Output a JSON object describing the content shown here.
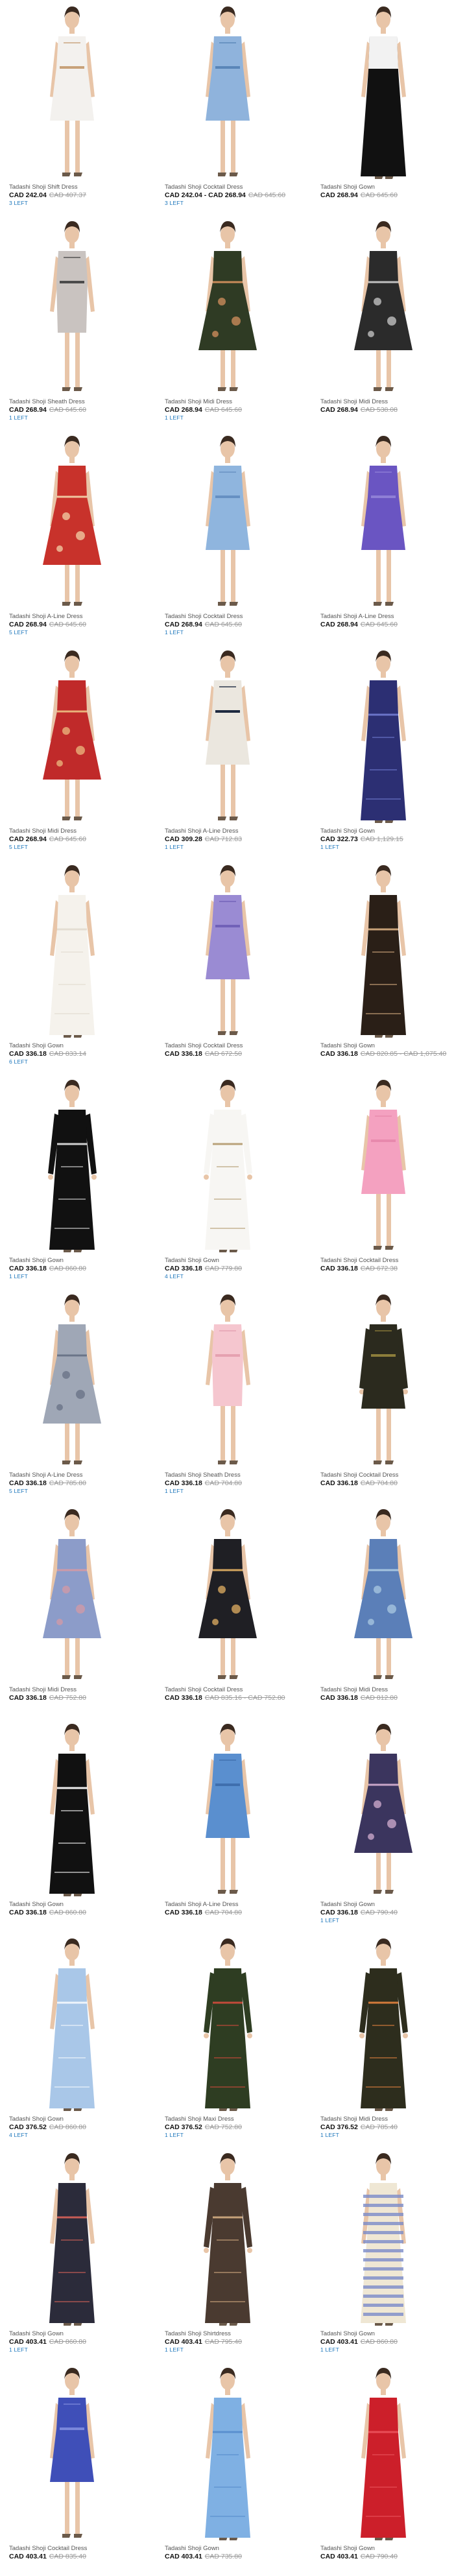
{
  "products": [
    {
      "title": "Tadashi Shoji Shift Dress",
      "price": "CAD 242.04",
      "was": "CAD 407.37",
      "stock": "3 LEFT",
      "color": "#f3f1ee",
      "accent": "#c8a27a",
      "style": "short",
      "icon": "dress-icon"
    },
    {
      "title": "Tadashi Shoji Cocktail Dress",
      "price": "CAD 242.04 - CAD 268.94",
      "was": "CAD 645.60",
      "stock": "3 LEFT",
      "color": "#8fb3dc",
      "accent": "#5a86b8",
      "style": "short",
      "icon": "dress-icon"
    },
    {
      "title": "Tadashi Shoji Gown",
      "price": "CAD 268.94",
      "was": "CAD 645.60",
      "stock": "",
      "color": "#111111",
      "accent": "#f2f2f2",
      "style": "gown-white-top",
      "icon": "gown-icon"
    },
    {
      "title": "Tadashi Shoji Sheath Dress",
      "price": "CAD 268.94",
      "was": "CAD 645.60",
      "stock": "1 LEFT",
      "color": "#c9c3c0",
      "accent": "#4b4b4b",
      "style": "sheath",
      "icon": "dress-icon"
    },
    {
      "title": "Tadashi Shoji Midi Dress",
      "price": "CAD 268.94",
      "was": "CAD 645.60",
      "stock": "1 LEFT",
      "color": "#2f3b24",
      "accent": "#c98b5a",
      "style": "midi",
      "icon": "dress-icon"
    },
    {
      "title": "Tadashi Shoji Midi Dress",
      "price": "CAD 268.94",
      "was": "CAD 538.08",
      "stock": "",
      "color": "#2b2b2b",
      "accent": "#c0c0c0",
      "style": "midi",
      "icon": "dress-icon"
    },
    {
      "title": "Tadashi Shoji A-Line Dress",
      "price": "CAD 268.94",
      "was": "CAD 645.60",
      "stock": "5 LEFT",
      "color": "#c8322b",
      "accent": "#f0c7a0",
      "style": "midi",
      "icon": "dress-icon"
    },
    {
      "title": "Tadashi Shoji Cocktail Dress",
      "price": "CAD 268.94",
      "was": "CAD 645.60",
      "stock": "1 LEFT",
      "color": "#8fb5de",
      "accent": "#6690c2",
      "style": "short",
      "icon": "dress-icon"
    },
    {
      "title": "Tadashi Shoji A-Line Dress",
      "price": "CAD 268.94",
      "was": "CAD 645.60",
      "stock": "",
      "color": "#6a55c2",
      "accent": "#8f7fd6",
      "style": "short",
      "icon": "dress-icon"
    },
    {
      "title": "Tadashi Shoji Midi Dress",
      "price": "CAD 268.94",
      "was": "CAD 645.60",
      "stock": "5 LEFT",
      "color": "#c02a2a",
      "accent": "#e8b27a",
      "style": "midi",
      "icon": "dress-icon"
    },
    {
      "title": "Tadashi Shoji A-Line Dress",
      "price": "CAD 309.28",
      "was": "CAD 712.83",
      "stock": "1 LEFT",
      "color": "#ebe7df",
      "accent": "#1e2a40",
      "style": "short",
      "icon": "dress-icon"
    },
    {
      "title": "Tadashi Shoji Gown",
      "price": "CAD 322.73",
      "was": "CAD 1,129.15",
      "stock": "1 LEFT",
      "color": "#2c2f73",
      "accent": "#6b74c9",
      "style": "gown",
      "icon": "gown-icon"
    },
    {
      "title": "Tadashi Shoji Gown",
      "price": "CAD 336.18",
      "was": "CAD 833.14",
      "stock": "6 LEFT",
      "color": "#f5f2ec",
      "accent": "#e3ddd2",
      "style": "gown",
      "icon": "gown-icon"
    },
    {
      "title": "Tadashi Shoji Cocktail Dress",
      "price": "CAD 336.18",
      "was": "CAD 672.50",
      "stock": "",
      "color": "#9a8bd3",
      "accent": "#7161b8",
      "style": "short",
      "icon": "dress-icon"
    },
    {
      "title": "Tadashi Shoji Gown",
      "price": "CAD 336.18",
      "was": "CAD 820.85 - CAD 1,075.40",
      "stock": "",
      "color": "#2a1f17",
      "accent": "#c8a278",
      "style": "gown",
      "icon": "gown-icon"
    },
    {
      "title": "Tadashi Shoji Gown",
      "price": "CAD 336.18",
      "was": "CAD 860.80",
      "stock": "1 LEFT",
      "color": "#111111",
      "accent": "#cfcfcf",
      "style": "gown-sleeve",
      "icon": "gown-icon"
    },
    {
      "title": "Tadashi Shoji Gown",
      "price": "CAD 336.18",
      "was": "CAD 779.80",
      "stock": "4 LEFT",
      "color": "#f7f6f3",
      "accent": "#b9a27a",
      "style": "gown-sleeve",
      "icon": "gown-icon"
    },
    {
      "title": "Tadashi Shoji Cocktail Dress",
      "price": "CAD 336.18",
      "was": "CAD 672.38",
      "stock": "",
      "color": "#f4a1c0",
      "accent": "#e889ad",
      "style": "short",
      "icon": "dress-icon"
    },
    {
      "title": "Tadashi Shoji A-Line Dress",
      "price": "CAD 336.18",
      "was": "CAD 785.80",
      "stock": "5 LEFT",
      "color": "#9fa7b6",
      "accent": "#6a7488",
      "style": "midi",
      "icon": "dress-icon"
    },
    {
      "title": "Tadashi Shoji Sheath Dress",
      "price": "CAD 336.18",
      "was": "CAD 704.80",
      "stock": "1 LEFT",
      "color": "#f5c6cf",
      "accent": "#e5a1b0",
      "style": "sheath",
      "icon": "dress-icon"
    },
    {
      "title": "Tadashi Shoji Cocktail Dress",
      "price": "CAD 336.18",
      "was": "CAD 704.80",
      "stock": "",
      "color": "#2b2a1e",
      "accent": "#8c7d3a",
      "style": "short-sleeve",
      "icon": "dress-icon"
    },
    {
      "title": "Tadashi Shoji Midi Dress",
      "price": "CAD 336.18",
      "was": "CAD 752.80",
      "stock": "",
      "color": "#8c9cc9",
      "accent": "#cf9aa7",
      "style": "midi",
      "icon": "dress-icon"
    },
    {
      "title": "Tadashi Shoji Cocktail Dress",
      "price": "CAD 336.18",
      "was": "CAD 835.16 - CAD 752.80",
      "stock": "",
      "color": "#1f1f24",
      "accent": "#d4a55e",
      "style": "midi",
      "icon": "dress-icon"
    },
    {
      "title": "Tadashi Shoji Midi Dress",
      "price": "CAD 336.18",
      "was": "CAD 812.80",
      "stock": "",
      "color": "#5b7fb8",
      "accent": "#a5c4df",
      "style": "midi",
      "icon": "dress-icon"
    },
    {
      "title": "Tadashi Shoji Gown",
      "price": "CAD 336.18",
      "was": "CAD 860.80",
      "stock": "",
      "color": "#111111",
      "accent": "#ececec",
      "style": "gown",
      "icon": "gown-icon"
    },
    {
      "title": "Tadashi Shoji A-Line Dress",
      "price": "CAD 336.18",
      "was": "CAD 704.80",
      "stock": "",
      "color": "#5a8fcf",
      "accent": "#3f6fae",
      "style": "short",
      "icon": "dress-icon"
    },
    {
      "title": "Tadashi Shoji Gown",
      "price": "CAD 336.18",
      "was": "CAD 790.40",
      "stock": "1 LEFT",
      "color": "#3b355e",
      "accent": "#c9a6c8",
      "style": "midi",
      "icon": "gown-icon"
    },
    {
      "title": "Tadashi Shoji Gown",
      "price": "CAD 376.52",
      "was": "CAD 860.80",
      "stock": "4 LEFT",
      "color": "#a9c7e8",
      "accent": "#eef4fb",
      "style": "gown",
      "icon": "gown-icon"
    },
    {
      "title": "Tadashi Shoji Maxi Dress",
      "price": "CAD 376.52",
      "was": "CAD 752.80",
      "stock": "1 LEFT",
      "color": "#2e3d22",
      "accent": "#c24a3a",
      "style": "gown-sleeve",
      "icon": "gown-icon"
    },
    {
      "title": "Tadashi Shoji Midi Dress",
      "price": "CAD 376.52",
      "was": "CAD 785.40",
      "stock": "1 LEFT",
      "color": "#2d2d1d",
      "accent": "#d27a3b",
      "style": "gown-sleeve",
      "icon": "gown-icon"
    },
    {
      "title": "Tadashi Shoji Gown",
      "price": "CAD 403.41",
      "was": "CAD 860.80",
      "stock": "1 LEFT",
      "color": "#2b2b3a",
      "accent": "#c85d55",
      "style": "gown",
      "icon": "gown-icon"
    },
    {
      "title": "Tadashi Shoji Shirtdress",
      "price": "CAD 403.41",
      "was": "CAD 795.40",
      "stock": "1 LEFT",
      "color": "#4a3a30",
      "accent": "#c7a27a",
      "style": "gown-sleeve",
      "icon": "gown-icon"
    },
    {
      "title": "Tadashi Shoji Gown",
      "price": "CAD 403.41",
      "was": "CAD 860.80",
      "stock": "1 LEFT",
      "color": "#efe7d4",
      "accent": "#7b8bc8",
      "style": "gown-stripe",
      "icon": "gown-icon"
    },
    {
      "title": "Tadashi Shoji Cocktail Dress",
      "price": "CAD 403.41",
      "was": "CAD 835.40",
      "stock": "",
      "color": "#3f4fb8",
      "accent": "#7a87da",
      "style": "short",
      "icon": "dress-icon"
    },
    {
      "title": "Tadashi Shoji Gown",
      "price": "CAD 403.41",
      "was": "CAD 735.80",
      "stock": "",
      "color": "#7fb0e3",
      "accent": "#5a8fcf",
      "style": "gown",
      "icon": "gown-icon"
    },
    {
      "title": "Tadashi Shoji Gown",
      "price": "CAD 403.41",
      "was": "CAD 790.40",
      "stock": "",
      "color": "#cc1f2a",
      "accent": "#e84e57",
      "style": "gown",
      "icon": "gown-icon"
    }
  ]
}
